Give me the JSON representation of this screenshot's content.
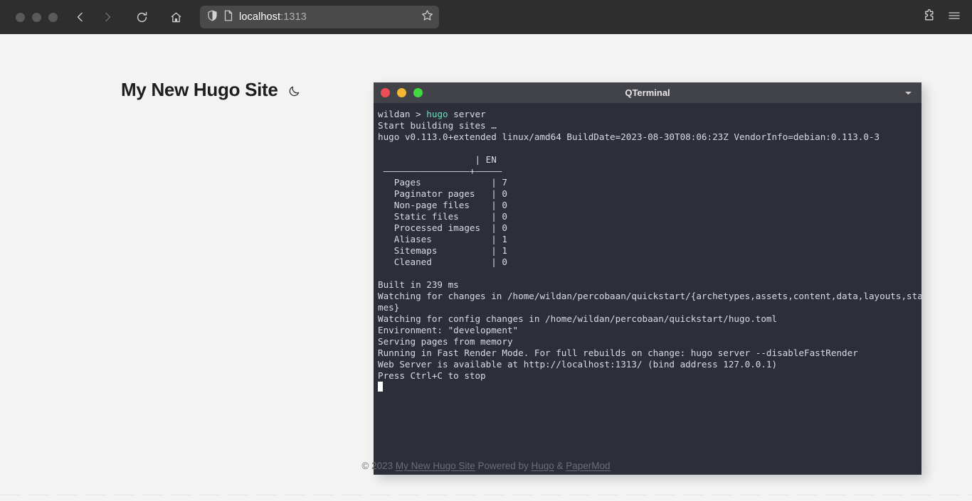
{
  "browser": {
    "window_dots": [
      "close",
      "minimize",
      "maximize"
    ],
    "nav": {
      "back": "back-arrow",
      "forward": "forward-arrow",
      "reload": "reload",
      "home": "home"
    },
    "urlbar": {
      "shield_icon": "shield-icon",
      "page_icon": "page-icon",
      "host": "localhost",
      "port": ":1313",
      "bookmark_icon": "star-icon"
    },
    "toolbar_right": {
      "extensions_icon": "puzzle-icon",
      "menu_icon": "hamburger-menu-icon"
    }
  },
  "site": {
    "title": "My New Hugo Site",
    "theme_toggle_icon": "moon-icon"
  },
  "terminal": {
    "title": "QTerminal",
    "titlebar_menu_icon": "chevron-down-icon",
    "traffic_lights": {
      "close": "#ef4f54",
      "minimize": "#f5b731",
      "maximize": "#3fdb3f"
    },
    "prompt": {
      "user": "wildan",
      "symbol": ">",
      "command_keyword": "hugo",
      "command_args": " server"
    },
    "lines_before_table": [
      "Start building sites …",
      "hugo v0.113.0+extended linux/amd64 BuildDate=2023-08-30T08:06:23Z VendorInfo=debian:0.113.0-3"
    ],
    "table": {
      "column_header": "EN",
      "header_row": "                  | EN",
      "separator_row": " ————————————————+—————",
      "rows": [
        {
          "label": "Pages",
          "value": "7"
        },
        {
          "label": "Paginator pages",
          "value": "0"
        },
        {
          "label": "Non-page files",
          "value": "0"
        },
        {
          "label": "Static files",
          "value": "0"
        },
        {
          "label": "Processed images",
          "value": "0"
        },
        {
          "label": "Aliases",
          "value": "1"
        },
        {
          "label": "Sitemaps",
          "value": "1"
        },
        {
          "label": "Cleaned",
          "value": "0"
        }
      ]
    },
    "lines_after_table": [
      "Built in 239 ms",
      "Watching for changes in /home/wildan/percobaan/quickstart/{archetypes,assets,content,data,layouts,static,the",
      "mes}",
      "Watching for config changes in /home/wildan/percobaan/quickstart/hugo.toml",
      "Environment: \"development\"",
      "Serving pages from memory",
      "Running in Fast Render Mode. For full rebuilds on change: hugo server --disableFastRender",
      "Web Server is available at http://localhost:1313/ (bind address 127.0.0.1)",
      "Press Ctrl+C to stop"
    ]
  },
  "footer": {
    "copyright": "© 2023 ",
    "site_link": "My New Hugo Site",
    "powered_by": " Powered by ",
    "hugo_link": "Hugo",
    "amp": " & ",
    "papermod_link": "PaperMod"
  },
  "colors": {
    "page_bg": "#f3f3f3",
    "browser_chrome": "#2e2e2e",
    "terminal_bg": "#2c2f3a",
    "terminal_titlebar": "#414348",
    "terminal_text": "#d8dce3",
    "terminal_keyword": "#6ee0bc"
  }
}
